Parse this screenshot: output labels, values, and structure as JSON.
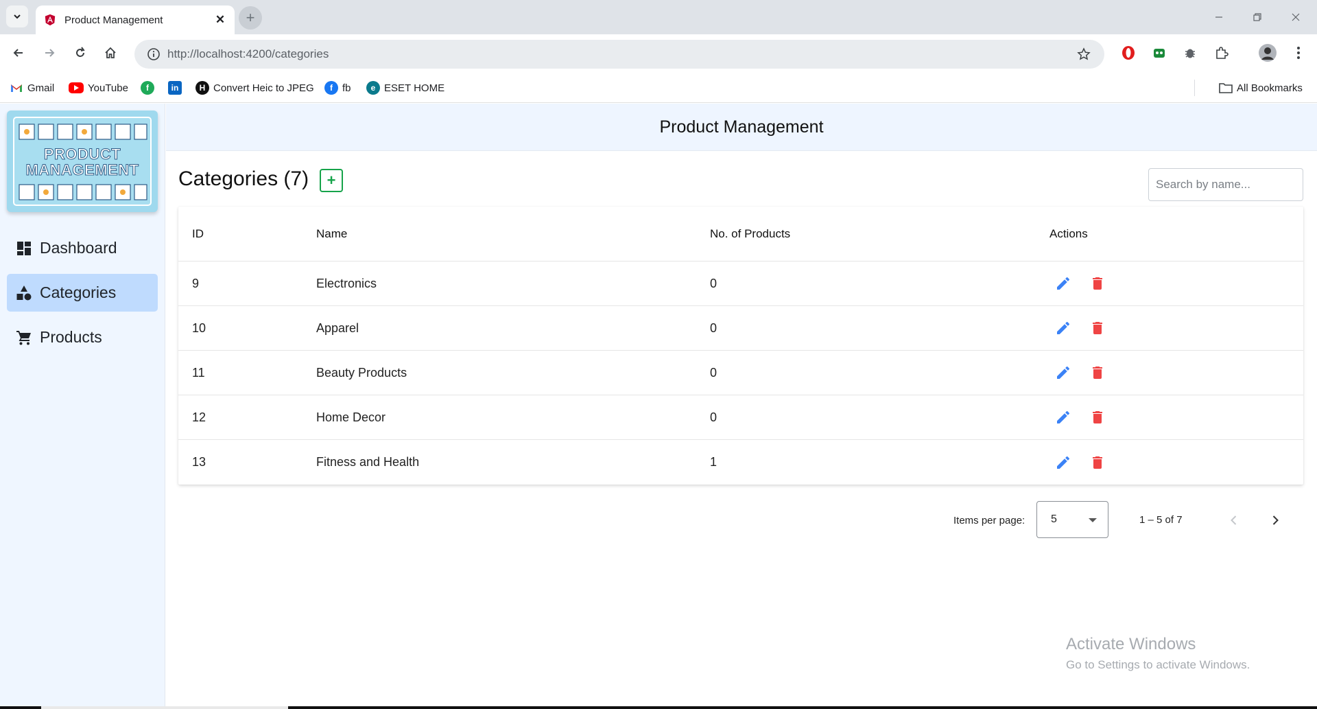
{
  "browser": {
    "tab_title": "Product Management",
    "url": "http://localhost:4200/categories",
    "bookmarks": [
      {
        "label": "Gmail",
        "icon": "gmail-icon"
      },
      {
        "label": "YouTube",
        "icon": "youtube-icon"
      },
      {
        "label": "",
        "icon": "green-circle-icon"
      },
      {
        "label": "",
        "icon": "linkedin-icon"
      },
      {
        "label": "Convert Heic to JPEG",
        "icon": "heic-h-icon"
      },
      {
        "label": "fb",
        "icon": "facebook-icon"
      },
      {
        "label": "ESET HOME",
        "icon": "eset-icon"
      }
    ],
    "all_bookmarks": "All Bookmarks"
  },
  "sidebar": {
    "logo_lines": [
      "PRODUCT",
      "MANAGEMENT"
    ],
    "items": [
      {
        "label": "Dashboard",
        "icon": "dashboard-icon",
        "active": false
      },
      {
        "label": "Categories",
        "icon": "shapes-icon",
        "active": true
      },
      {
        "label": "Products",
        "icon": "cart-icon",
        "active": false
      }
    ]
  },
  "header": {
    "title": "Product Management"
  },
  "page": {
    "title": "Categories (7)",
    "add_label": "+",
    "search_placeholder": "Search by name..."
  },
  "table": {
    "columns": [
      "ID",
      "Name",
      "No. of Products",
      "Actions"
    ],
    "rows": [
      {
        "id": "9",
        "name": "Electronics",
        "count": "0"
      },
      {
        "id": "10",
        "name": "Apparel",
        "count": "0"
      },
      {
        "id": "11",
        "name": "Beauty Products",
        "count": "0"
      },
      {
        "id": "12",
        "name": "Home Decor",
        "count": "0"
      },
      {
        "id": "13",
        "name": "Fitness and Health",
        "count": "1"
      }
    ]
  },
  "paginator": {
    "items_per_page_label": "Items per page:",
    "page_size": "5",
    "range": "1 – 5 of 7"
  },
  "watermark": {
    "title": "Activate Windows",
    "subtitle": "Go to Settings to activate Windows."
  },
  "colors": {
    "accent": "#3b82f6",
    "edit": "#3b82f6",
    "delete": "#ef4444",
    "add": "#16a34a",
    "active_nav": "#bfdbfe"
  }
}
